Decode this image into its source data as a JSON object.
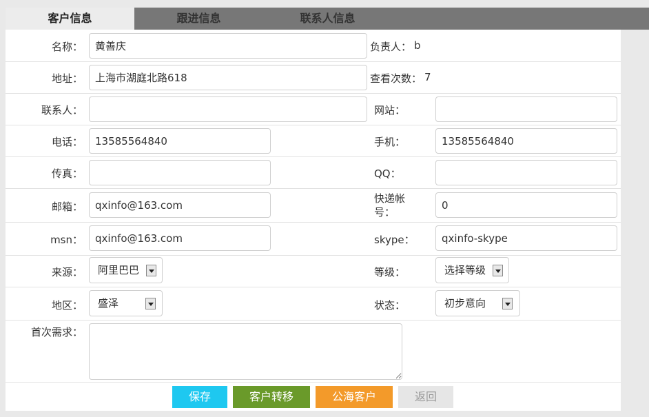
{
  "tabs": [
    {
      "label": "客户信息",
      "active": true
    },
    {
      "label": "跟进信息",
      "active": false
    },
    {
      "label": "联系人信息",
      "active": false
    }
  ],
  "form": {
    "name": {
      "label": "名称：",
      "value": "黄善庆"
    },
    "owner": {
      "label": "负责人：",
      "value": "b"
    },
    "address": {
      "label": "地址：",
      "value": "上海市湖庭北路618"
    },
    "views": {
      "label": "查看次数：",
      "value": "7"
    },
    "contact": {
      "label": "联系人：",
      "value": ""
    },
    "website": {
      "label": "网站：",
      "value": ""
    },
    "phone": {
      "label": "电话：",
      "value": "13585564840"
    },
    "mobile": {
      "label": "手机：",
      "value": "13585564840"
    },
    "fax": {
      "label": "传真：",
      "value": ""
    },
    "qq": {
      "label": "QQ：",
      "value": ""
    },
    "email": {
      "label": "邮箱：",
      "value": "qxinfo@163.com"
    },
    "express": {
      "label_line1": "快递帐",
      "label_line2": "号：",
      "value": "0"
    },
    "msn": {
      "label": "msn：",
      "value": "qxinfo@163.com"
    },
    "skype": {
      "label": "skype：",
      "value": "qxinfo-skype"
    },
    "source": {
      "label": "来源：",
      "selected": "阿里巴巴"
    },
    "level": {
      "label": "等级：",
      "selected": "选择等级"
    },
    "region": {
      "label": "地区：",
      "selected": "盛泽"
    },
    "status": {
      "label": "状态：",
      "selected": "初步意向"
    },
    "first_need": {
      "label": "首次需求：",
      "value": ""
    }
  },
  "buttons": {
    "save": "保存",
    "transfer": "客户转移",
    "public": "公海客户",
    "back": "返回"
  },
  "colors": {
    "tab_bar": "#777777",
    "save": "#1ec8f0",
    "transfer": "#6a9a2a",
    "public": "#f39a2a",
    "back": "#e6e6e6"
  }
}
